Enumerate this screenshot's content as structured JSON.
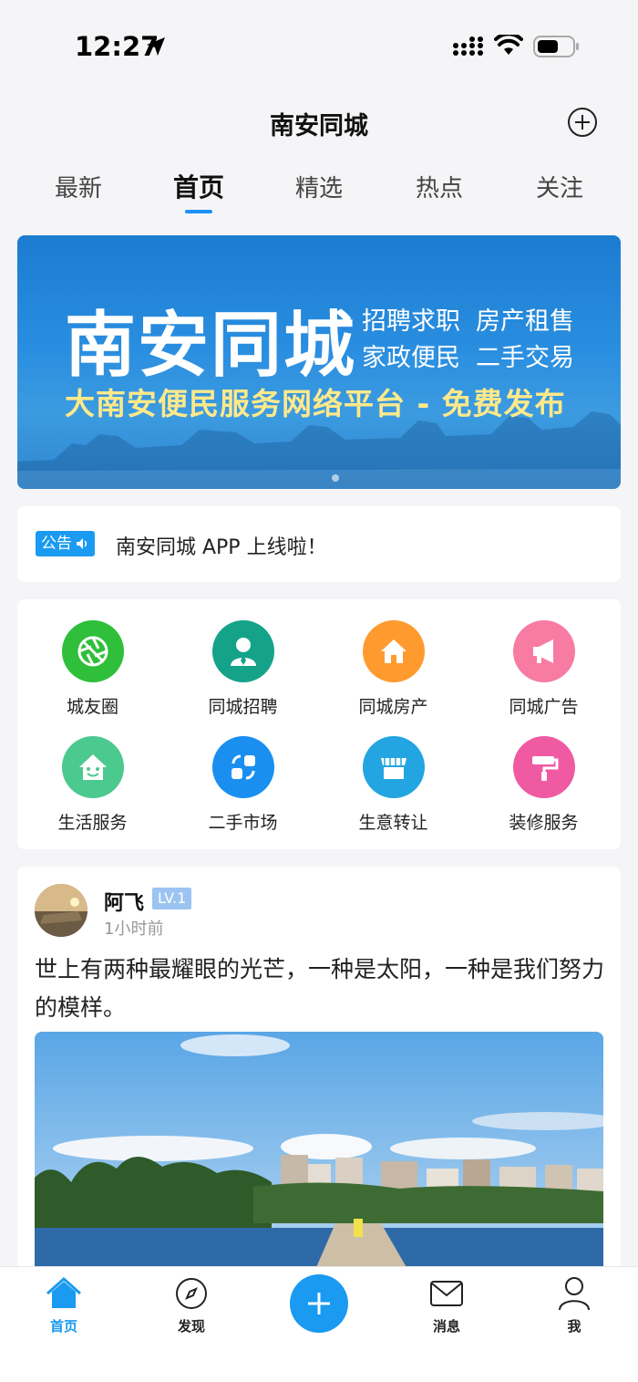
{
  "status": {
    "time": "12:27"
  },
  "header": {
    "title": "南安同城"
  },
  "tabs": [
    {
      "label": "最新"
    },
    {
      "label": "首页"
    },
    {
      "label": "精选"
    },
    {
      "label": "热点"
    },
    {
      "label": "关注"
    }
  ],
  "banner": {
    "title": "南安同城",
    "tags": [
      "招聘求职",
      "房产租售",
      "家政便民",
      "二手交易"
    ],
    "subtitle": "大南安便民服务网络平台 - 免费发布"
  },
  "notice": {
    "badge": "公告",
    "text": "南安同城 APP 上线啦！"
  },
  "grid": [
    {
      "label": "城友圈",
      "color": "#2fbf3a",
      "icon": "aperture-icon"
    },
    {
      "label": "同城招聘",
      "color": "#14a389",
      "icon": "person-icon"
    },
    {
      "label": "同城房产",
      "color": "#ff9a2e",
      "icon": "house-icon"
    },
    {
      "label": "同城广告",
      "color": "#f77ba3",
      "icon": "megaphone-icon"
    },
    {
      "label": "生活服务",
      "color": "#4cc98e",
      "icon": "smile-house-icon"
    },
    {
      "label": "二手市场",
      "color": "#1a8ff0",
      "icon": "exchange-icon"
    },
    {
      "label": "生意转让",
      "color": "#22a5e0",
      "icon": "shop-icon"
    },
    {
      "label": "装修服务",
      "color": "#f05aa3",
      "icon": "paint-roller-icon"
    }
  ],
  "post": {
    "user": "阿飞",
    "level": "LV.1",
    "time": "1小时前",
    "text": "世上有两种最耀眼的光芒，一种是太阳，一种是我们努力的模样。"
  },
  "bottom_nav": [
    {
      "label": "首页",
      "icon": "home-icon"
    },
    {
      "label": "发现",
      "icon": "compass-icon"
    },
    {
      "label": "",
      "icon": "plus-icon"
    },
    {
      "label": "消息",
      "icon": "mail-icon"
    },
    {
      "label": "我",
      "icon": "user-icon"
    }
  ],
  "colors": {
    "accent": "#1a9af0",
    "background": "#f5f5f7"
  }
}
